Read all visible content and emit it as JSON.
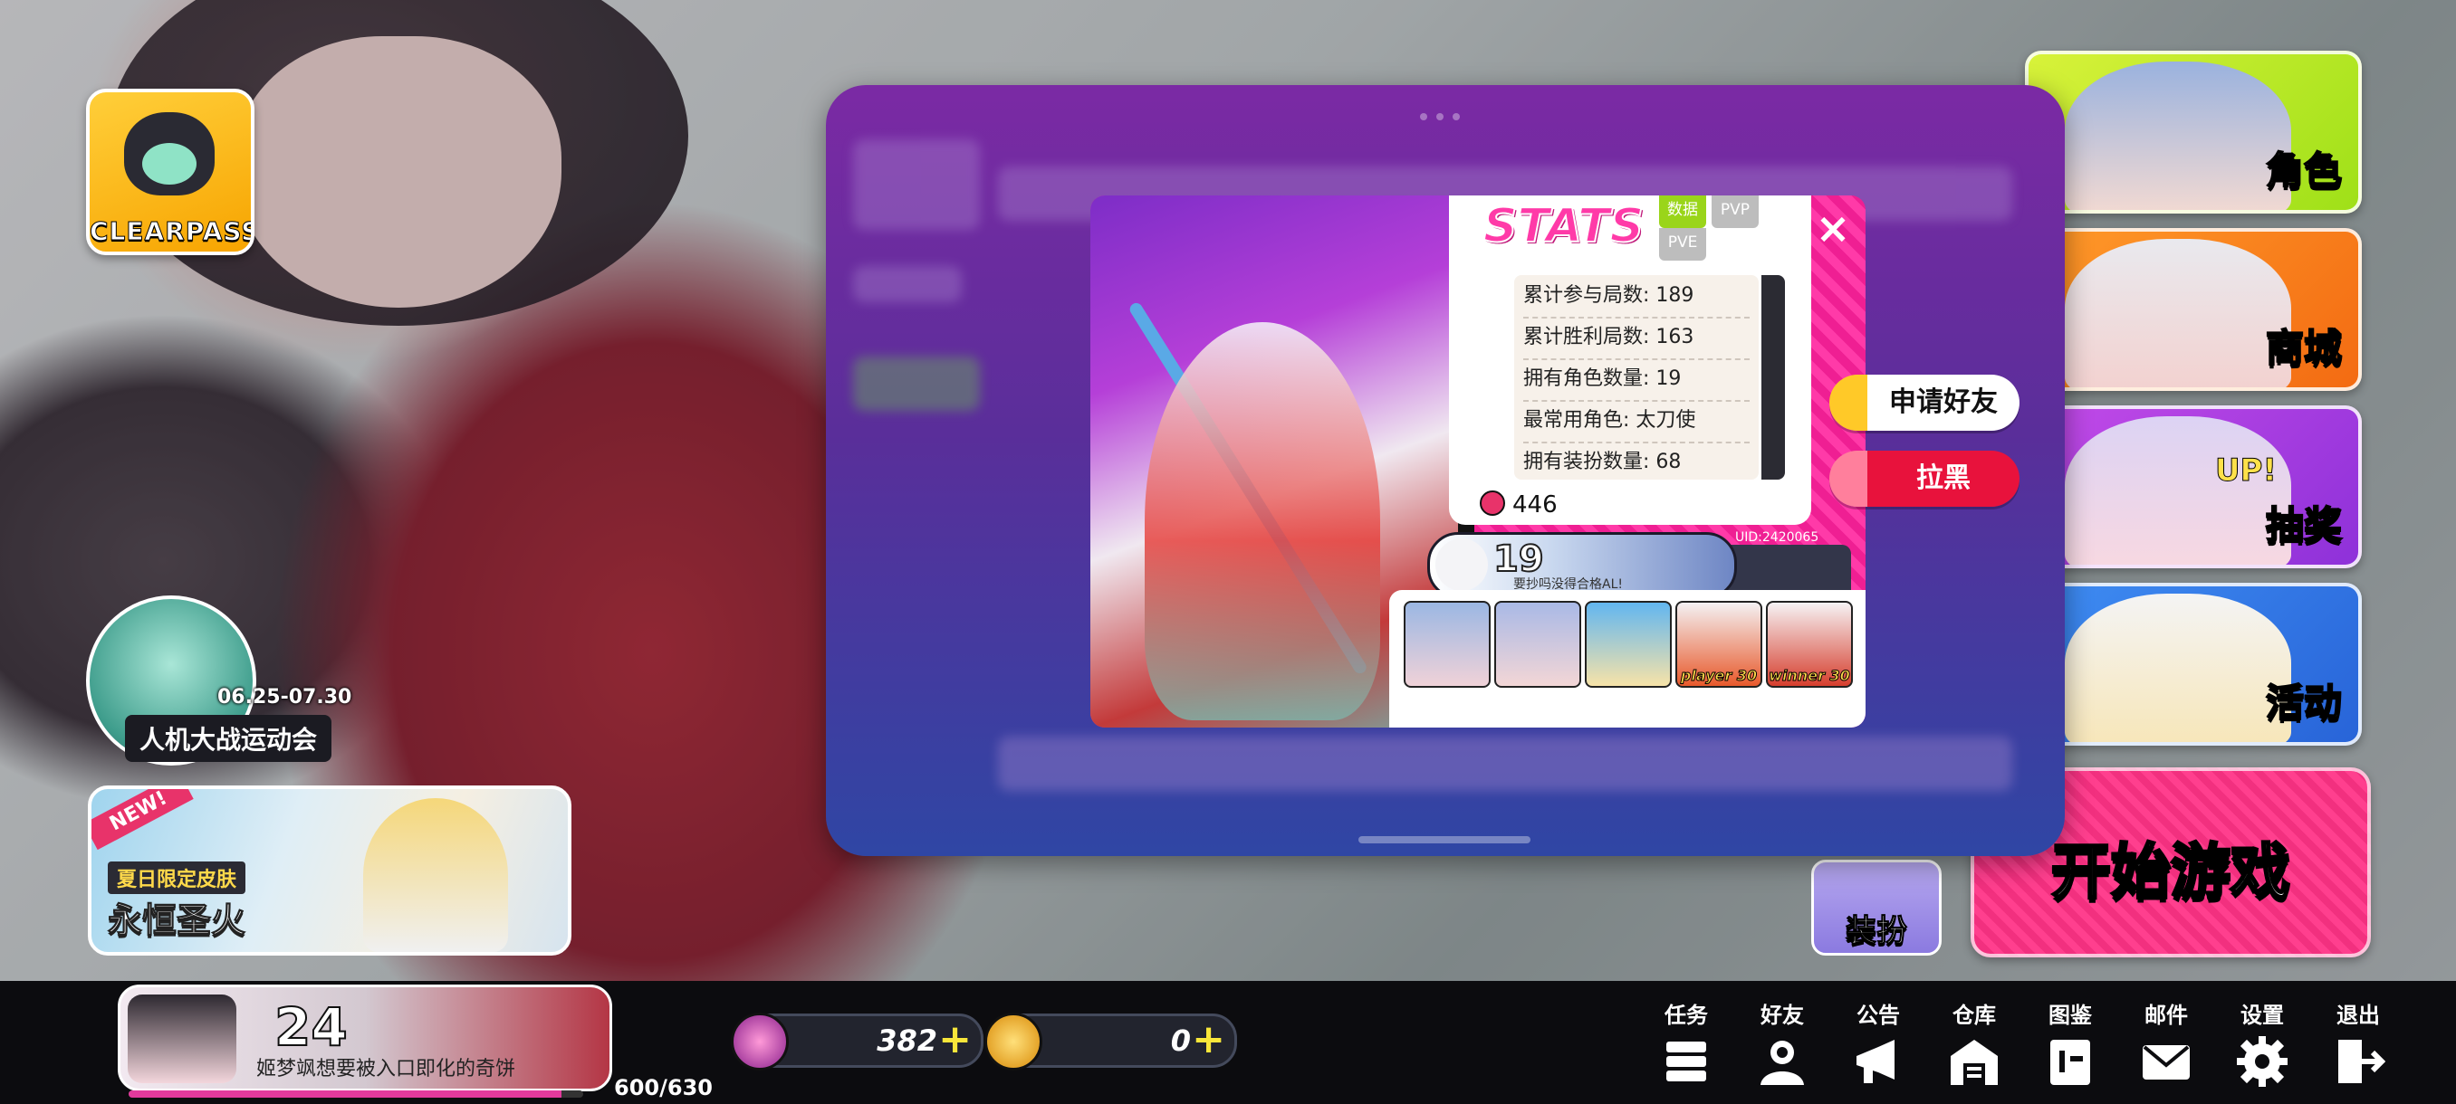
{
  "left": {
    "clearpass_label": "CLEARPASS",
    "event": {
      "date": "06.25-07.30",
      "title": "人机大战运动会"
    },
    "skin_banner": {
      "tag": "NEW!",
      "subtitle": "夏日限定皮肤",
      "title": "永恒圣火"
    }
  },
  "right_menu": {
    "role": "角色",
    "shop": "商城",
    "gacha": "抽奖",
    "gacha_badge": "UP!",
    "event": "活动",
    "start": "开始游戏",
    "dress": "装扮"
  },
  "profile_card": {
    "stats_title": "STATS",
    "tabs": [
      "数据",
      "PVP",
      "PVE"
    ],
    "active_tab": "数据",
    "stats": [
      {
        "label": "累计参与局数:",
        "value": "189"
      },
      {
        "label": "累计胜利局数:",
        "value": "163"
      },
      {
        "label": "拥有角色数量:",
        "value": "19"
      },
      {
        "label": "最常用角色:",
        "value": "太刀使"
      },
      {
        "label": "拥有装扮数量:",
        "value": "68"
      }
    ],
    "coins": "446",
    "close_icon": "×",
    "level": "19",
    "signature": "要抄吗没得合格AL!",
    "uid": "UID:2420065",
    "badges": [
      {
        "text": ""
      },
      {
        "text": ""
      },
      {
        "text": ""
      },
      {
        "text": "player 30"
      },
      {
        "text": "winner 30"
      }
    ],
    "actions": {
      "add_friend": "申请好友",
      "block": "拉黑"
    }
  },
  "bottom": {
    "level": "24",
    "signature": "姬梦飒想要被入口即化的奇饼",
    "xp": "600/630",
    "xp_fraction": 0.952,
    "currency": [
      {
        "name": "gem",
        "value": "382",
        "color": "#c03aa8"
      },
      {
        "name": "gold",
        "value": "0",
        "color": "#f2a81c"
      }
    ],
    "nav": [
      {
        "label": "任务",
        "icon": "tasks-icon"
      },
      {
        "label": "好友",
        "icon": "friends-icon"
      },
      {
        "label": "公告",
        "icon": "megaphone-icon"
      },
      {
        "label": "仓库",
        "icon": "warehouse-icon"
      },
      {
        "label": "图鉴",
        "icon": "collection-icon"
      },
      {
        "label": "邮件",
        "icon": "mail-icon"
      },
      {
        "label": "设置",
        "icon": "gear-icon"
      },
      {
        "label": "退出",
        "icon": "exit-icon"
      }
    ]
  }
}
